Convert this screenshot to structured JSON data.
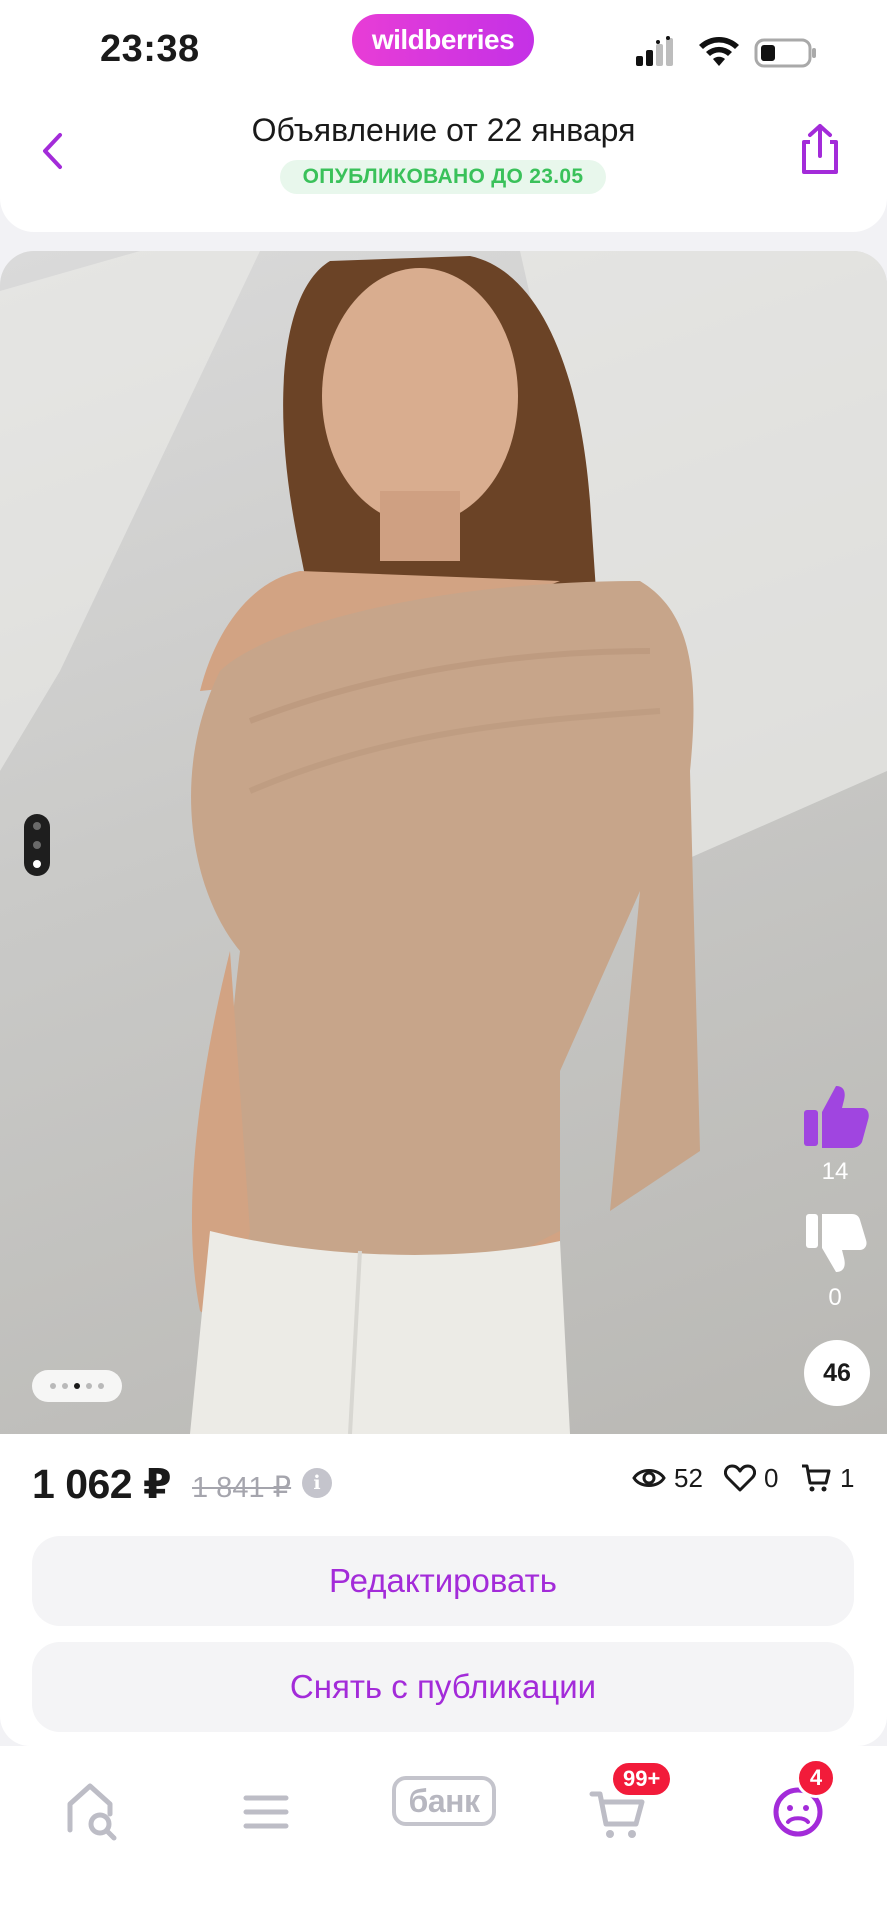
{
  "status_bar": {
    "time": "23:38",
    "brand": "wildberries"
  },
  "header": {
    "title": "Объявление от 22 января",
    "status_badge": "ОПУБЛИКОВАНО ДО 23.05"
  },
  "photo": {
    "vertical_pager": {
      "count": 3,
      "active": 3
    },
    "horizontal_pager": {
      "count": 5,
      "active": 4
    },
    "likes": "14",
    "dislikes": "0",
    "comments": "46"
  },
  "pricing": {
    "price": "1 062 ₽",
    "old_price": "1 841 ₽",
    "info_icon_glyph": "i"
  },
  "stats": {
    "views": "52",
    "favorites": "0",
    "cart": "1"
  },
  "actions": {
    "edit_label": "Редактировать",
    "unpublish_label": "Снять с публикации"
  },
  "bottom_nav": {
    "items": [
      "home-search-icon",
      "menu-icon",
      "bank",
      "cart-icon",
      "profile-icon"
    ],
    "bank_label": "банк",
    "cart_badge": "99+",
    "profile_badge": "4"
  },
  "colors": {
    "accent": "#a32bd9",
    "brand_pink": "#e83dd6",
    "badge_green_text": "#3ac15a",
    "badge_green_bg": "#e8f7ec",
    "alert_red": "#f21b3a"
  }
}
